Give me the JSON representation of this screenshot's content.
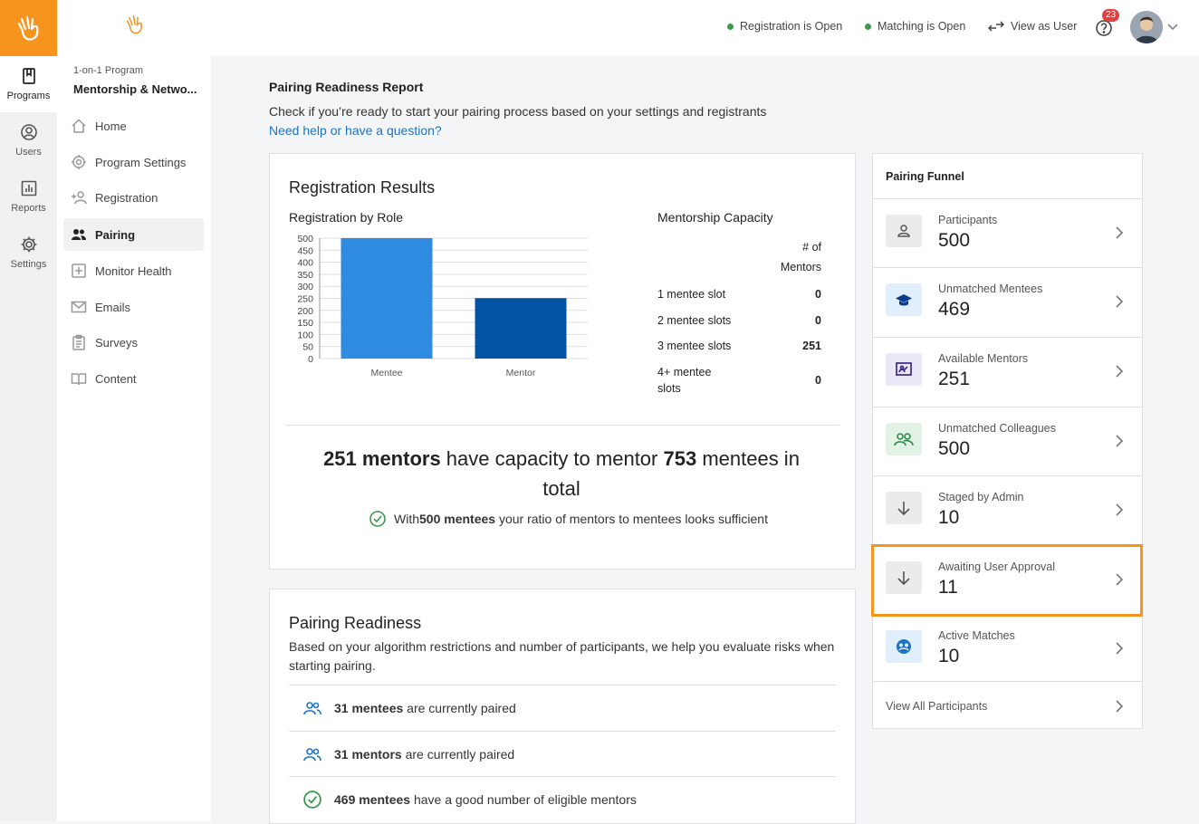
{
  "rail": {
    "items": [
      {
        "label": "Programs",
        "icon": "book-icon"
      },
      {
        "label": "Users",
        "icon": "user-circle-icon"
      },
      {
        "label": "Reports",
        "icon": "bar-chart-icon"
      },
      {
        "label": "Settings",
        "icon": "gear-icon"
      }
    ]
  },
  "sidebar": {
    "program_type": "1-on-1 Program",
    "program_name": "Mentorship & Netwo...",
    "items": [
      {
        "label": "Home"
      },
      {
        "label": "Program Settings"
      },
      {
        "label": "Registration"
      },
      {
        "label": "Pairing"
      },
      {
        "label": "Monitor Health"
      },
      {
        "label": "Emails"
      },
      {
        "label": "Surveys"
      },
      {
        "label": "Content"
      }
    ]
  },
  "topbar": {
    "registration_status": "Registration is Open",
    "matching_status": "Matching is Open",
    "view_as_user": "View as User",
    "notification_count": "23"
  },
  "page": {
    "title": "Pairing Readiness Report",
    "subtitle": "Check if you’re ready to start your pairing process based on your settings and registrants",
    "help_link": "Need help or have a question?"
  },
  "registration": {
    "title": "Registration Results",
    "chart_title": "Registration by Role",
    "capacity_title": "Mentorship Capacity",
    "capacity_header_1": "# of",
    "capacity_header_2": "Mentors",
    "capacity_rows": [
      {
        "label": "1 mentee slot",
        "value": "0"
      },
      {
        "label": "2 mentee slots",
        "value": "0"
      },
      {
        "label": "3 mentee slots",
        "value": "251"
      },
      {
        "label": "4+ mentee slots",
        "value": "0"
      }
    ],
    "summary_mentors": "251 mentors",
    "summary_mid": " have capacity to mentor ",
    "summary_mentees": "753",
    "summary_end": " mentees in total",
    "ratio_pre": "With ",
    "ratio_bold": "500 mentees",
    "ratio_post": " your ratio of mentors to mentees looks sufficient"
  },
  "chart_data": {
    "type": "bar",
    "categories": [
      "Mentee",
      "Mentor"
    ],
    "values": [
      500,
      251
    ],
    "ylim": [
      0,
      500
    ],
    "yticks": [
      0,
      50,
      100,
      150,
      200,
      250,
      300,
      350,
      400,
      450,
      500
    ],
    "colors": [
      "#2f8be0",
      "#0353a4"
    ],
    "grid": true
  },
  "readiness": {
    "title": "Pairing Readiness",
    "description": "Based on your algorithm restrictions and number of participants, we help you evaluate risks when starting pairing.",
    "rows": [
      {
        "bold": "31 mentees",
        "text": " are currently paired"
      },
      {
        "bold": "31 mentors",
        "text": " are currently paired"
      },
      {
        "bold": "469 mentees",
        "text": " have a good number of eligible mentors"
      }
    ]
  },
  "funnel": {
    "title": "Pairing Funnel",
    "rows": [
      {
        "label": "Participants",
        "value": "500"
      },
      {
        "label": "Unmatched Mentees",
        "value": "469"
      },
      {
        "label": "Available Mentors",
        "value": "251"
      },
      {
        "label": "Unmatched Colleagues",
        "value": "500"
      },
      {
        "label": "Staged by Admin",
        "value": "10"
      },
      {
        "label": "Awaiting User Approval",
        "value": "11"
      },
      {
        "label": "Active Matches",
        "value": "10"
      }
    ],
    "view_all": "View All Participants"
  },
  "colors": {
    "brand": "#f7941d",
    "link": "#1d72c4",
    "success": "#3a9a4a"
  }
}
